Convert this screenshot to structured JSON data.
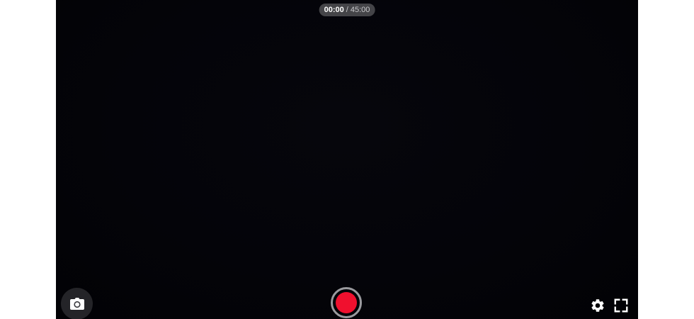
{
  "recorder": {
    "timer": {
      "elapsed": "00:00",
      "separator": "/",
      "total": "45:00"
    },
    "controls": {
      "snapshot_icon": "camera-icon",
      "record_icon": "record-icon",
      "settings_icon": "gear-icon",
      "fullscreen_icon": "fullscreen-icon"
    },
    "colors": {
      "viewport_background": "#040409",
      "record_red": "#f0102e",
      "record_ring": "#9a9a9e",
      "icon_white": "#ffffff",
      "timer_pill": "#505054"
    }
  }
}
